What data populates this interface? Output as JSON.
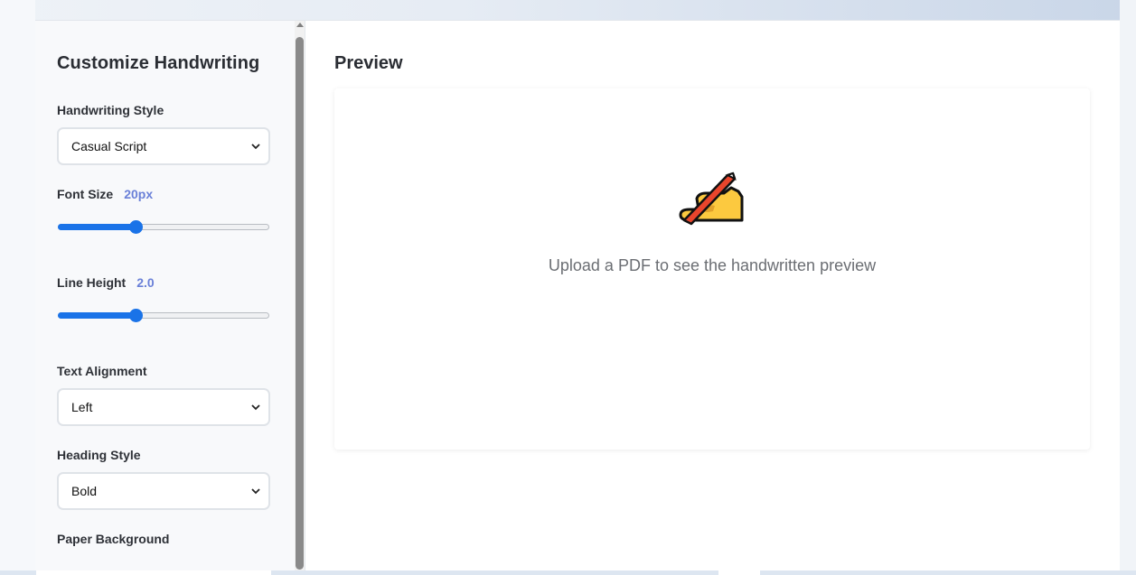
{
  "sidebar": {
    "title": "Customize Handwriting",
    "handwriting_style": {
      "label": "Handwriting Style",
      "selected": "Casual Script"
    },
    "font_size": {
      "label": "Font Size",
      "value": "20px",
      "fraction": 0.36
    },
    "line_height": {
      "label": "Line Height",
      "value": "2.0",
      "fraction": 0.36
    },
    "text_alignment": {
      "label": "Text Alignment",
      "selected": "Left"
    },
    "heading_style": {
      "label": "Heading Style",
      "selected": "Bold"
    },
    "paper_background": {
      "label": "Paper Background"
    }
  },
  "main": {
    "title": "Preview",
    "empty_message": "Upload a PDF to see the handwritten preview",
    "icon": "writing-hand-icon"
  },
  "colors": {
    "accent": "#1a73e8",
    "value_text": "#6a80d8"
  }
}
